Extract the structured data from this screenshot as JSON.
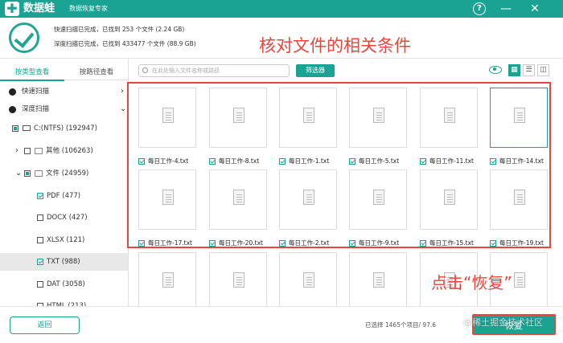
{
  "app": {
    "name": "数据蛙",
    "subtitle": "数据恢复专家",
    "help_glyph": "?",
    "minimize_glyph": "—",
    "close_glyph": "✕"
  },
  "scan": {
    "quick": "快速扫描已完成，已找到 253 个文件 (2.24 GB)",
    "deep": "深度扫描已完成，已找到 433477 个文件 (88.9 GB)"
  },
  "annotation_top": "核对文件的相关条件",
  "annotation_bottom": "点击“恢复”",
  "sidebar": {
    "tabs": [
      "按类型查看",
      "按路径查看"
    ],
    "sections": [
      {
        "label": "快速扫描",
        "arrow": "›"
      },
      {
        "label": "深度扫描",
        "arrow": "⌄"
      }
    ],
    "tree": {
      "drive": "C:(NTFS) (192947)",
      "other": "其他 (106263)",
      "file": "文件 (24959)",
      "types": [
        "PDF (477)",
        "DOCX (427)",
        "XLSX (121)",
        "TXT (988)",
        "DAT (3058)",
        "HTML (213)"
      ]
    },
    "expander_closed": "›",
    "expander_open": "⌄"
  },
  "toolbar": {
    "search_placeholder": "在此处输入文件名称或路径",
    "filter_label": "筛选器",
    "view_icons": [
      "▦",
      "☰",
      "◫"
    ]
  },
  "files": [
    "每日工作-4.txt",
    "每日工作-8.txt",
    "每日工作-1.txt",
    "每日工作-5.txt",
    "每日工作-11.txt",
    "每日工作-14.txt",
    "每日工作-17.txt",
    "每日工作-20.txt",
    "每日工作-2.txt",
    "每日工作-9.txt",
    "每日工作-15.txt",
    "每日工作-19.txt"
  ],
  "footer": {
    "back_label": "返回",
    "selection_info": "已选择 1465个项目/ 97.6",
    "recover_label": "恢复"
  },
  "watermark": "@稀土掘金技术社区",
  "colors": {
    "accent": "#1aa293",
    "annotation": "#e8453c"
  }
}
